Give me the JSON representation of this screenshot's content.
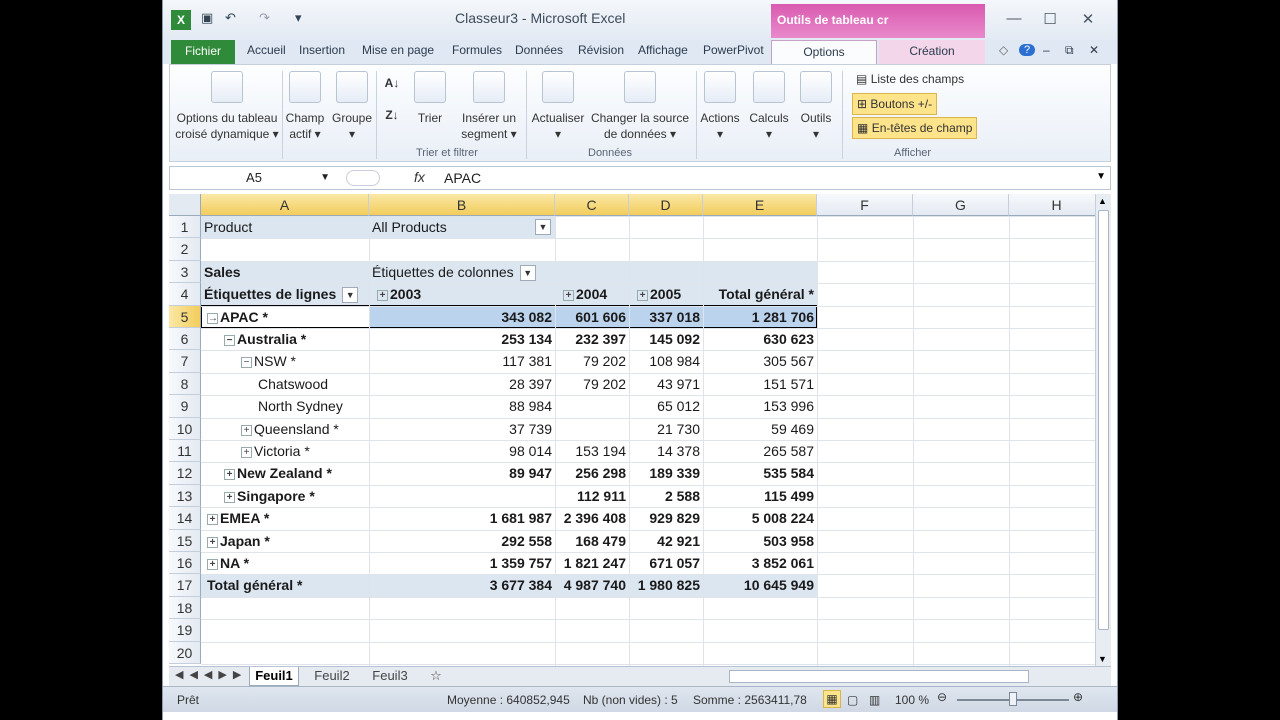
{
  "app": {
    "title": "Classeur3 - Microsoft Excel",
    "context_tab_header": "Outils de tableau cr"
  },
  "tabs": [
    "Fichier",
    "Accueil",
    "Insertion",
    "Mise en page",
    "Formules",
    "Données",
    "Révision",
    "Affichage",
    "PowerPivot",
    "Options",
    "Création"
  ],
  "ribbon": {
    "options_tableau": "Options du tableau croisé dynamique",
    "champ_actif": "Champ actif",
    "groupe": "Groupe",
    "trier": "Trier",
    "inserer_segment": "Insérer un segment",
    "actualiser": "Actualiser",
    "changer_source": "Changer la source de données",
    "actions": "Actions",
    "calculs": "Calculs",
    "outils": "Outils",
    "liste_champs": "Liste des champs",
    "boutons": "Boutons +/-",
    "entetes": "En-têtes de champ",
    "group_trier": "Trier et filtrer",
    "group_donnees": "Données",
    "group_afficher": "Afficher"
  },
  "formula_bar": {
    "name_box": "A5",
    "fx": "fx",
    "content": "APAC"
  },
  "columns": [
    "A",
    "B",
    "C",
    "D",
    "E",
    "F",
    "G",
    "H"
  ],
  "rows": [
    {
      "n": "1",
      "a": "Product",
      "b": "All Products"
    },
    {
      "n": "2"
    },
    {
      "n": "3",
      "a": "Sales",
      "b": "Étiquettes de colonnes"
    },
    {
      "n": "4",
      "a": "Étiquettes de lignes",
      "b": "2003",
      "c": "2004",
      "d": "2005",
      "e": "Total général *"
    },
    {
      "n": "5",
      "a": "APAC *",
      "b": "343 082",
      "c": "601 606",
      "d": "337 018",
      "e": "1 281 706"
    },
    {
      "n": "6",
      "a": "Australia *",
      "b": "253 134",
      "c": "232 397",
      "d": "145 092",
      "e": "630 623"
    },
    {
      "n": "7",
      "a": "NSW *",
      "b": "117 381",
      "c": "79 202",
      "d": "108 984",
      "e": "305 567"
    },
    {
      "n": "8",
      "a": "Chatswood",
      "b": "28 397",
      "c": "79 202",
      "d": "43 971",
      "e": "151 571"
    },
    {
      "n": "9",
      "a": "North Sydney",
      "b": "88 984",
      "c": "",
      "d": "65 012",
      "e": "153 996"
    },
    {
      "n": "10",
      "a": "Queensland *",
      "b": "37 739",
      "c": "",
      "d": "21 730",
      "e": "59 469"
    },
    {
      "n": "11",
      "a": "Victoria *",
      "b": "98 014",
      "c": "153 194",
      "d": "14 378",
      "e": "265 587"
    },
    {
      "n": "12",
      "a": "New Zealand *",
      "b": "89 947",
      "c": "256 298",
      "d": "189 339",
      "e": "535 584"
    },
    {
      "n": "13",
      "a": "Singapore *",
      "b": "",
      "c": "112 911",
      "d": "2 588",
      "e": "115 499"
    },
    {
      "n": "14",
      "a": "EMEA *",
      "b": "1 681 987",
      "c": "2 396 408",
      "d": "929 829",
      "e": "5 008 224"
    },
    {
      "n": "15",
      "a": "Japan *",
      "b": "292 558",
      "c": "168 479",
      "d": "42 921",
      "e": "503 958"
    },
    {
      "n": "16",
      "a": "NA *",
      "b": "1 359 757",
      "c": "1 821 247",
      "d": "671 057",
      "e": "3 852 061"
    },
    {
      "n": "17",
      "a": "Total général *",
      "b": "3 677 384",
      "c": "4 987 740",
      "d": "1 980 825",
      "e": "10 645 949"
    },
    {
      "n": "18"
    },
    {
      "n": "19"
    },
    {
      "n": "20"
    }
  ],
  "sheets": [
    "Feuil1",
    "Feuil2",
    "Feuil3"
  ],
  "status": {
    "ready": "Prêt",
    "moyenne": "Moyenne : 640852,945",
    "nb": "Nb (non vides) : 5",
    "somme": "Somme : 2563411,78",
    "zoom": "100 %"
  },
  "colors": {
    "excel_green": "#2f8a3a",
    "context_pink": "#d95ab0",
    "pivot_band": "#dce6f1",
    "selection": "#f3cd5c"
  }
}
